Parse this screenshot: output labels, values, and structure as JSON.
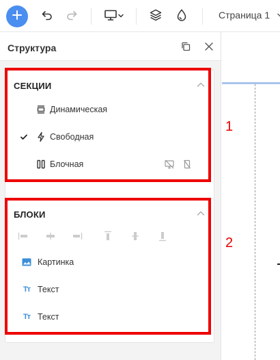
{
  "toolbar": {
    "icons": [
      "plus-icon",
      "undo-icon",
      "redo-icon",
      "desktop-icon",
      "chevron-down-icon",
      "layers-icon",
      "drop-icon"
    ],
    "page_label": "Страница 1"
  },
  "panel": {
    "title": "Структура"
  },
  "sections": {
    "title": "СЕКЦИИ",
    "items": [
      {
        "label": "Динамическая",
        "icon": "dynamic-section-icon",
        "checked": false
      },
      {
        "label": "Свободная",
        "icon": "lightning-icon",
        "checked": true
      },
      {
        "label": "Блочная",
        "icon": "columns-icon",
        "checked": false
      }
    ],
    "row_actions": [
      "hide-desktop-icon",
      "hide-mobile-icon"
    ]
  },
  "blocks": {
    "title": "БЛОКИ",
    "align_icons": [
      "align-left-icon",
      "align-center-h-icon",
      "align-right-icon",
      "align-top-icon",
      "align-center-v-icon",
      "align-bottom-icon"
    ],
    "items": [
      {
        "label": "Картинка",
        "icon": "image-icon"
      },
      {
        "label": "Текст",
        "icon": "text-icon",
        "glyph": "Tт"
      },
      {
        "label": "Текст",
        "icon": "text-icon",
        "glyph": "Tт"
      }
    ]
  },
  "annotations": {
    "first": "1",
    "second": "2",
    "color": "#ee0000"
  },
  "colors": {
    "accent": "#4a8ef0",
    "icon_blue": "#3b8fd9"
  }
}
